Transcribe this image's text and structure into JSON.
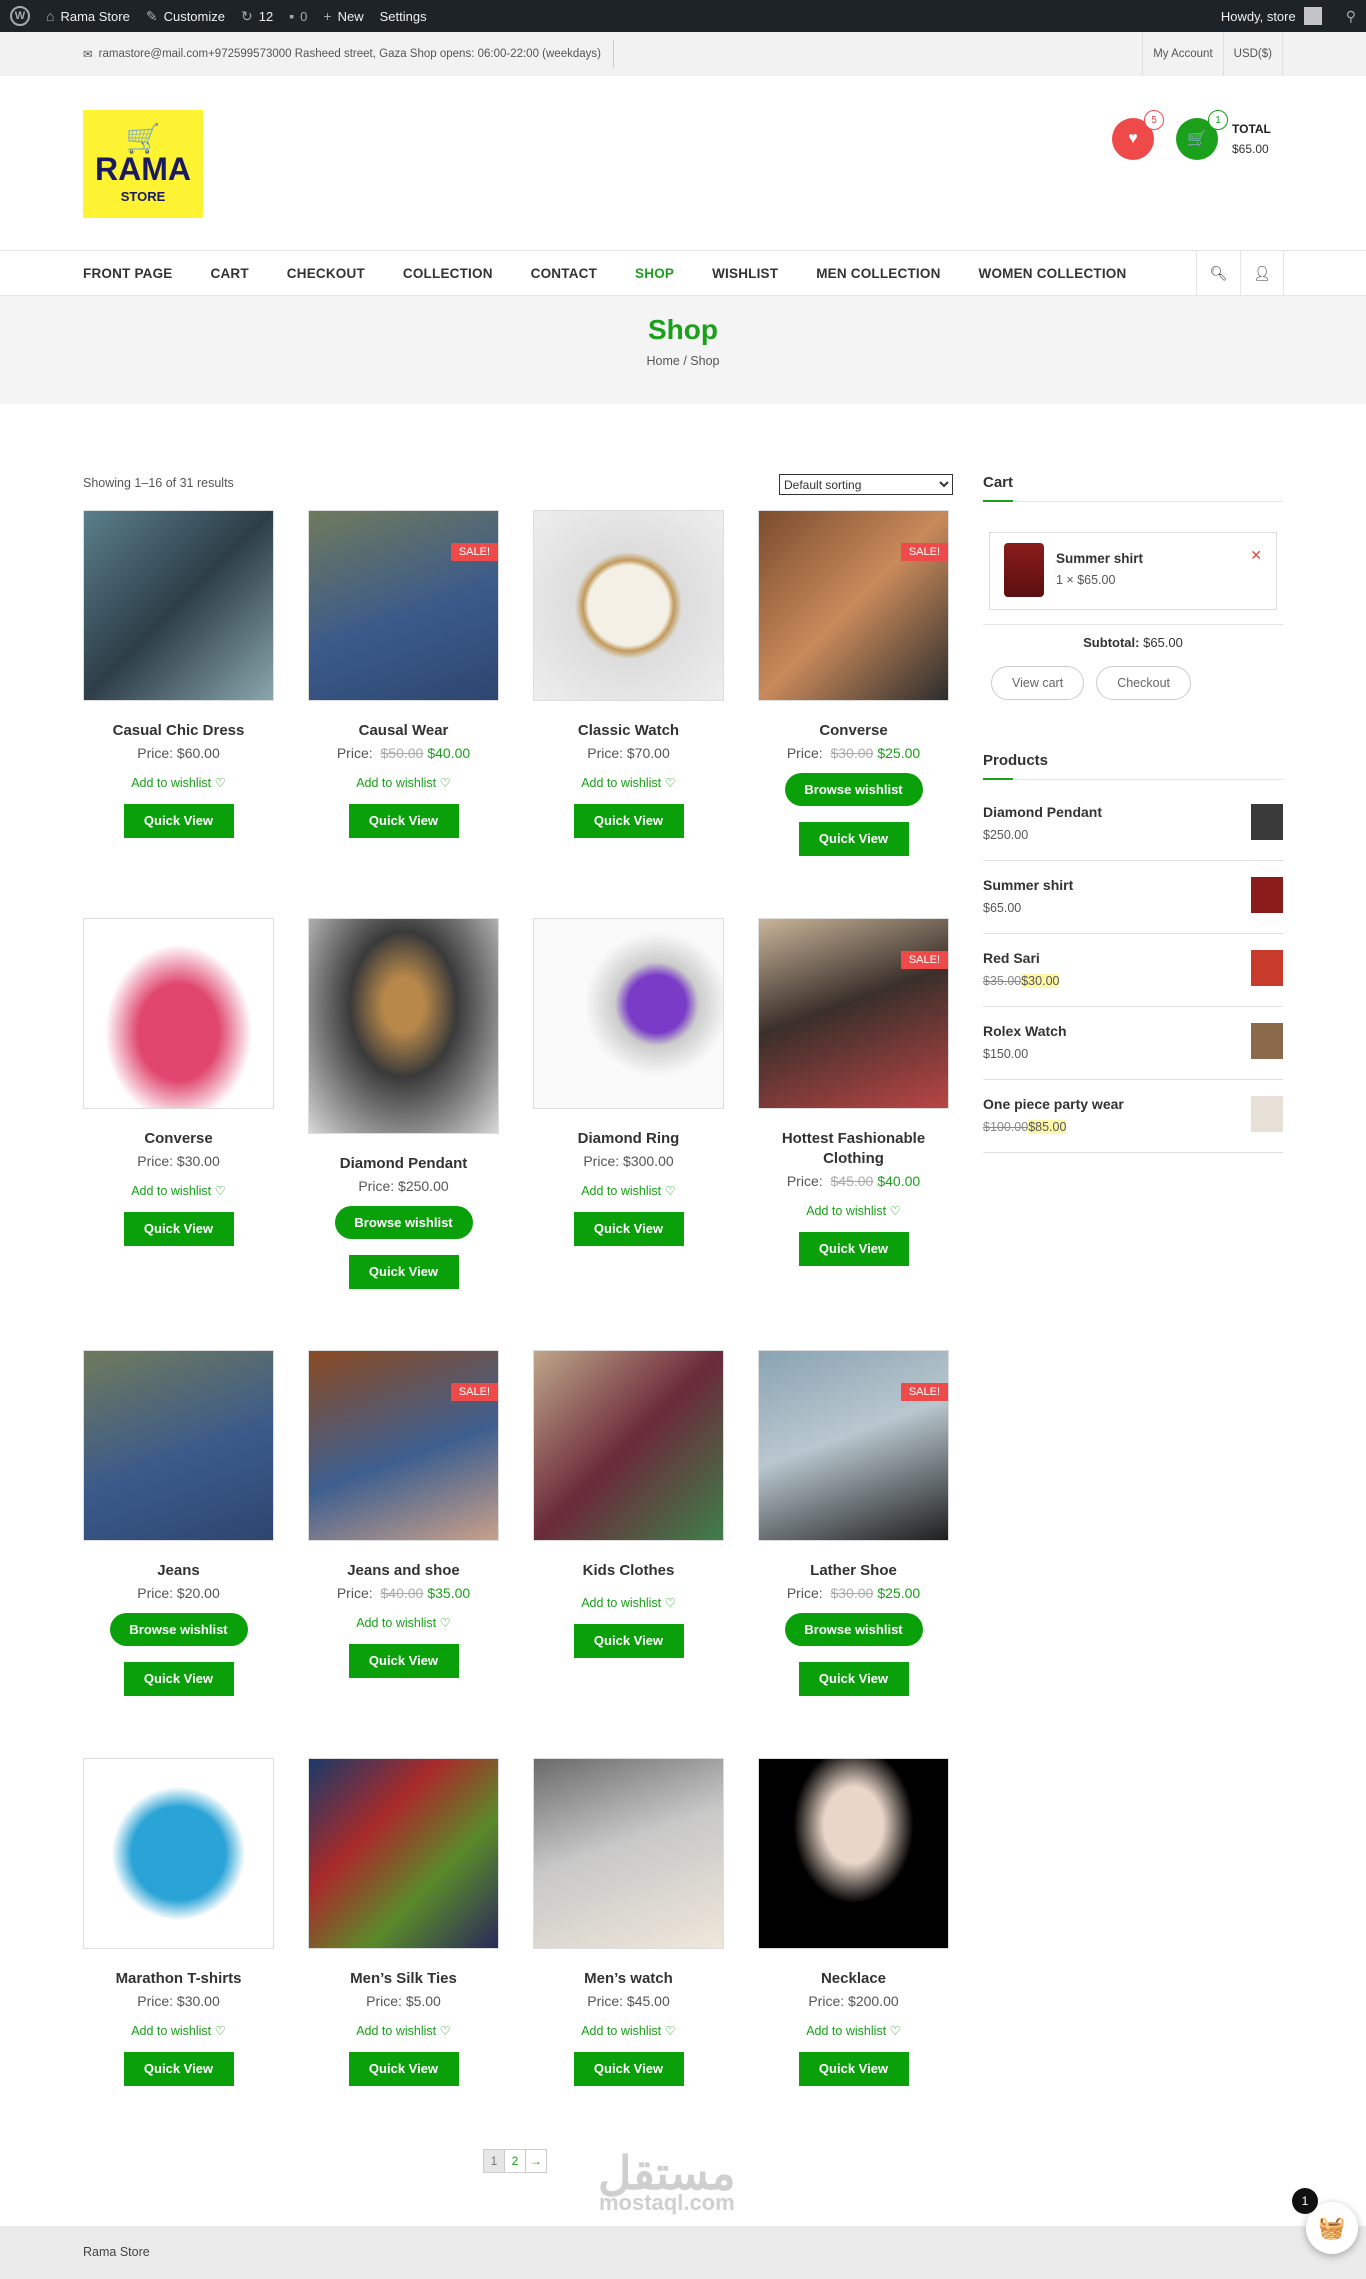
{
  "admin_bar": {
    "site": "Rama Store",
    "customize": "Customize",
    "updates": "12",
    "comments": "0",
    "new": "New",
    "settings": "Settings",
    "howdy": "Howdy, store"
  },
  "topbar": {
    "info": "ramastore@mail.com+972599573000 Rasheed street, Gaza  Shop opens: 06:00-22:00 (weekdays)",
    "my_account": "My Account",
    "currency": "USD($)"
  },
  "logo": {
    "main": "RAMA",
    "sub": "STORE"
  },
  "header": {
    "wishlist_count": "5",
    "cart_count": "1",
    "total_label": "TOTAL",
    "total_value": "$65.00"
  },
  "nav": {
    "items": [
      "FRONT PAGE",
      "CART",
      "CHECKOUT",
      "COLLECTION",
      "CONTACT",
      "SHOP",
      "WISHLIST",
      "MEN COLLECTION",
      "WOMEN COLLECTION"
    ],
    "active": "SHOP"
  },
  "page": {
    "title": "Shop",
    "breadcrumb": "Home / Shop"
  },
  "shop": {
    "showing": "Showing 1–16 of 31 results",
    "sort": "Default sorting",
    "quick_view": "Quick View",
    "add_wishlist": "Add to wishlist ♡",
    "browse_wishlist": "Browse wishlist",
    "sale_label": "SALE!",
    "price_label": "Price:"
  },
  "products": [
    {
      "name": "Casual Chic Dress",
      "price": "$60.00",
      "old": "",
      "sale": false,
      "action": "add",
      "icon": "dress-image"
    },
    {
      "name": "Causal Wear",
      "price": "$40.00",
      "old": "$50.00",
      "sale": true,
      "action": "add",
      "icon": "jeans-image"
    },
    {
      "name": "Classic Watch",
      "price": "$70.00",
      "old": "",
      "sale": false,
      "action": "add",
      "icon": "watch-image"
    },
    {
      "name": "Converse",
      "price": "$25.00",
      "old": "$30.00",
      "sale": true,
      "action": "browse",
      "icon": "sneaker-image"
    },
    {
      "name": "Converse",
      "price": "$30.00",
      "old": "",
      "sale": false,
      "action": "add",
      "icon": "running-shoe-image"
    },
    {
      "name": "Diamond Pendant",
      "price": "$250.00",
      "old": "",
      "sale": false,
      "action": "browse",
      "icon": "necklace-image"
    },
    {
      "name": "Diamond Ring",
      "price": "$300.00",
      "old": "",
      "sale": false,
      "action": "add",
      "icon": "ring-image"
    },
    {
      "name": "Hottest Fashionable Clothing",
      "price": "$40.00",
      "old": "$45.00",
      "sale": true,
      "action": "add",
      "icon": "party-dress-image"
    },
    {
      "name": "Jeans",
      "price": "$20.00",
      "old": "",
      "sale": false,
      "action": "browse",
      "icon": "jeans-image"
    },
    {
      "name": "Jeans and shoe",
      "price": "$35.00",
      "old": "$40.00",
      "sale": true,
      "action": "add",
      "icon": "jeans-shoe-image"
    },
    {
      "name": "Kids Clothes",
      "price": "",
      "old": "",
      "sale": false,
      "action": "add",
      "icon": "scarf-image"
    },
    {
      "name": "Lather Shoe",
      "price": "$25.00",
      "old": "$30.00",
      "sale": true,
      "action": "browse",
      "icon": "leather-shoe-image"
    },
    {
      "name": "Marathon T-shirts",
      "price": "$30.00",
      "old": "",
      "sale": false,
      "action": "add",
      "icon": "tshirt-image"
    },
    {
      "name": "Men’s Silk Ties",
      "price": "$5.00",
      "old": "",
      "sale": false,
      "action": "add",
      "icon": "ties-image"
    },
    {
      "name": "Men’s watch",
      "price": "$45.00",
      "old": "",
      "sale": false,
      "action": "add",
      "icon": "mens-watch-image"
    },
    {
      "name": "Necklace",
      "price": "$200.00",
      "old": "",
      "sale": false,
      "action": "add",
      "icon": "necklace-image"
    }
  ],
  "sidebar": {
    "cart_title": "Cart",
    "cart_item": "Summer shirt",
    "cart_qty": "1 × $65.00",
    "subtotal_label": "Subtotal:",
    "subtotal_value": "$65.00",
    "view_cart": "View cart",
    "checkout": "Checkout",
    "products_title": "Products",
    "products": [
      {
        "name": "Diamond Pendant",
        "price": "$250.00",
        "old": ""
      },
      {
        "name": "Summer shirt",
        "price": "$65.00",
        "old": ""
      },
      {
        "name": "Red Sari",
        "price": "$30.00",
        "old": "$35.00"
      },
      {
        "name": "Rolex Watch",
        "price": "$150.00",
        "old": ""
      },
      {
        "name": "One piece party wear",
        "price": "$85.00",
        "old": "$100.00"
      }
    ]
  },
  "pagination": [
    "1",
    "2",
    "→"
  ],
  "footer": {
    "text": "Rama Store"
  },
  "watermark": {
    "ar": "مستقل",
    "en": "mostaql.com"
  },
  "floating_cart": {
    "count": "1"
  },
  "colors": {
    "accent": "#1aa01a",
    "sale": "#ef4a4a",
    "button": "#0aa00a"
  }
}
